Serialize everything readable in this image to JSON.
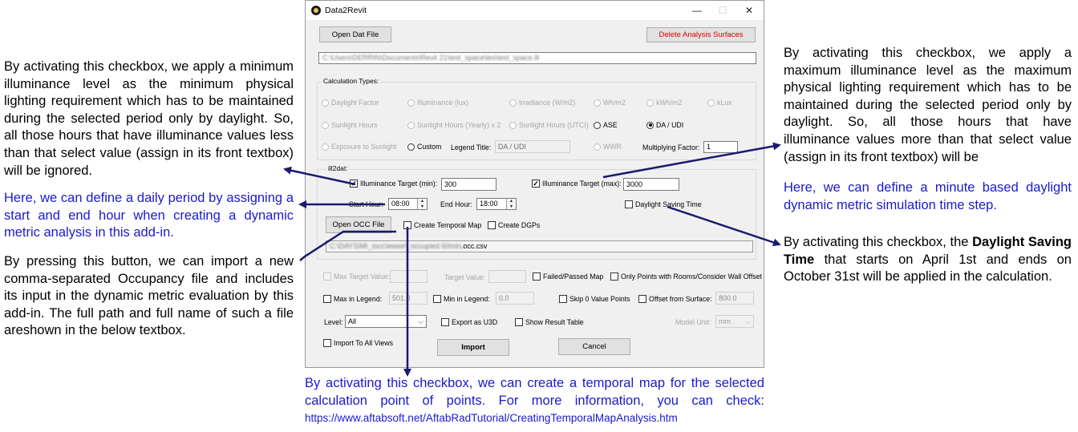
{
  "window": {
    "title": "Data2Revit",
    "minimize": "—",
    "maximize": "☐",
    "close": "✕"
  },
  "toolbar": {
    "open_dat_file": "Open Dat File",
    "delete_surfaces": "Delete Analysis Surfaces",
    "file_path": "C:\\Users\\DERRIN\\Documents\\Revit 21\\test_space\\ies\\test_space.ill"
  },
  "calc_types": {
    "label": "Calculation Types:",
    "row1": [
      "Daylight Factor",
      "Illuminance (lux)",
      "Irradiance (W/m2)",
      "Wh/m2",
      "kWh/m2",
      "kLux"
    ],
    "row2": [
      "Sunlight Hours",
      "Sunlight Hours (Yearly) x 2",
      "Sunlight Hours (UTCI)",
      "ASE",
      "DA / UDI"
    ],
    "row3_exposure": "Exposure to Sunlight",
    "row3_custom": "Custom",
    "legend_title_label": "Legend Title:",
    "legend_title_value": "DA / UDI",
    "wwr": "WWR",
    "multiplying_factor_label": "Multiplying Factor:",
    "multiplying_factor_value": "1",
    "selected": "DA / UDI"
  },
  "ill2dat": {
    "label": "ill2dat:",
    "illum_min_label": "Illuminance Target (min):",
    "illum_min_value": "300",
    "illum_max_label": "Illuminance Target (max):",
    "illum_max_value": "3000",
    "start_hour_label": "Start Hour:",
    "start_hour_value": "08:00",
    "end_hour_label": "End Hour:",
    "end_hour_value": "18:00",
    "dst_label": "Daylight Saving Time",
    "open_occ": "Open OCC File",
    "temporal_map": "Create Temporal Map",
    "create_dgps": "Create DGPs",
    "occ_path_blur": "C:\\DAYSIM\\_iocc\\ieeee\\_occupied 60min",
    "occ_path_ext": ".occ.csv"
  },
  "options": {
    "max_target_label": "Max Target Value:",
    "target_label": "Target Value:",
    "failed_passed": "Failed/Passed Map",
    "only_points": "Only Points with Rooms/Consider Wall Offset",
    "max_legend": "Max in Legend:",
    "max_legend_value": "501.0",
    "min_legend": "Min in Legend:",
    "min_legend_value": "0.0",
    "skip_zero": "Skip 0 Value Points",
    "offset_surface": "Offset from Surface:",
    "offset_value": "800.0",
    "level_label": "Level:",
    "level_value": "All",
    "export_u3d": "Export as U3D",
    "show_result_table": "Show Result Table",
    "model_unit_label": "Model Unit:",
    "model_unit_value": "mm",
    "import_all_views": "Import To All Views",
    "import": "Import",
    "cancel": "Cancel"
  },
  "annotations": {
    "left_min": "By activating this checkbox, we apply a minimum illuminance level as the minimum physical lighting requirement which has to be maintained during the selected period only by daylight. So, all those hours that have illuminance values less than that select value (assign in its front textbox) will be ignored.",
    "left_period": "Here, we can define a daily period by assigning a start and end hour when creating a dynamic metric analysis in this add-in.",
    "left_occ": "By pressing this button, we can import a new comma-separated Occupancy file and includes its input in the dynamic metric evaluation by this add-in. The full path and full name of such a file areshown in the below textbox.",
    "right_max": "By activating this checkbox, we apply a maximum illuminance level as the maximum physical lighting requirement which has to be maintained during the selected period only by daylight. So, all those hours that have illuminance values more than that select value (assign in its front textbox) will be",
    "right_timestep": "Here, we can define a minute based daylight dynamic metric simulation time step.",
    "right_dst_before": "By activating this checkbox, the ",
    "right_dst_bold": "Daylight Saving Time",
    "right_dst_after": " that starts on April 1st and ends on October 31st will be applied in the calculation.",
    "bottom_temporal": "By activating this checkbox, we can create a temporal map for the selected calculation point of points. For more information, you can check: ",
    "bottom_url": "https://www.aftabsoft.net/AftabRadTutorial/CreatingTemporalMapAnalysis.htm"
  },
  "colors": {
    "annotation_blue": "#1a1acc",
    "arrow_navy": "#1a1a6e",
    "delete_red": "#e00000"
  }
}
